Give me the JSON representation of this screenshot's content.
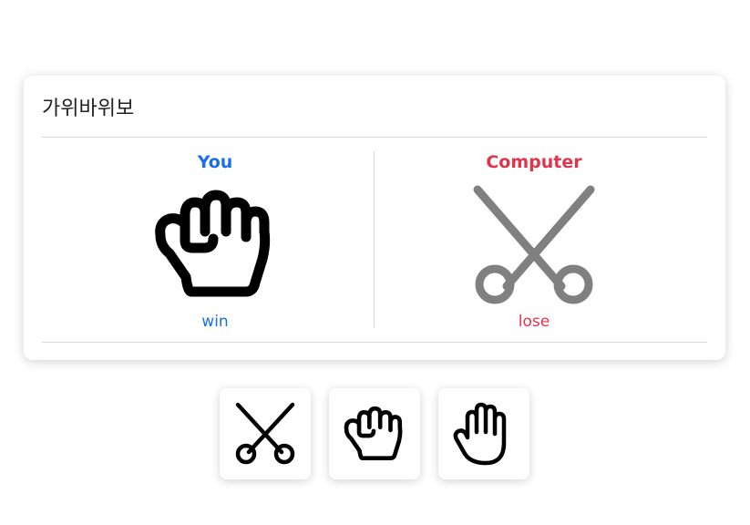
{
  "game": {
    "title": "가위바위보",
    "you": {
      "label": "You",
      "hand_icon": "rock-icon",
      "result": "win",
      "color": "#1a6fe8"
    },
    "computer": {
      "label": "Computer",
      "hand_icon": "scissors-icon",
      "result": "lose",
      "color": "#e0344a",
      "icon_color": "#808080"
    }
  },
  "choices": [
    {
      "icon": "scissors-icon"
    },
    {
      "icon": "rock-icon"
    },
    {
      "icon": "paper-icon"
    }
  ]
}
